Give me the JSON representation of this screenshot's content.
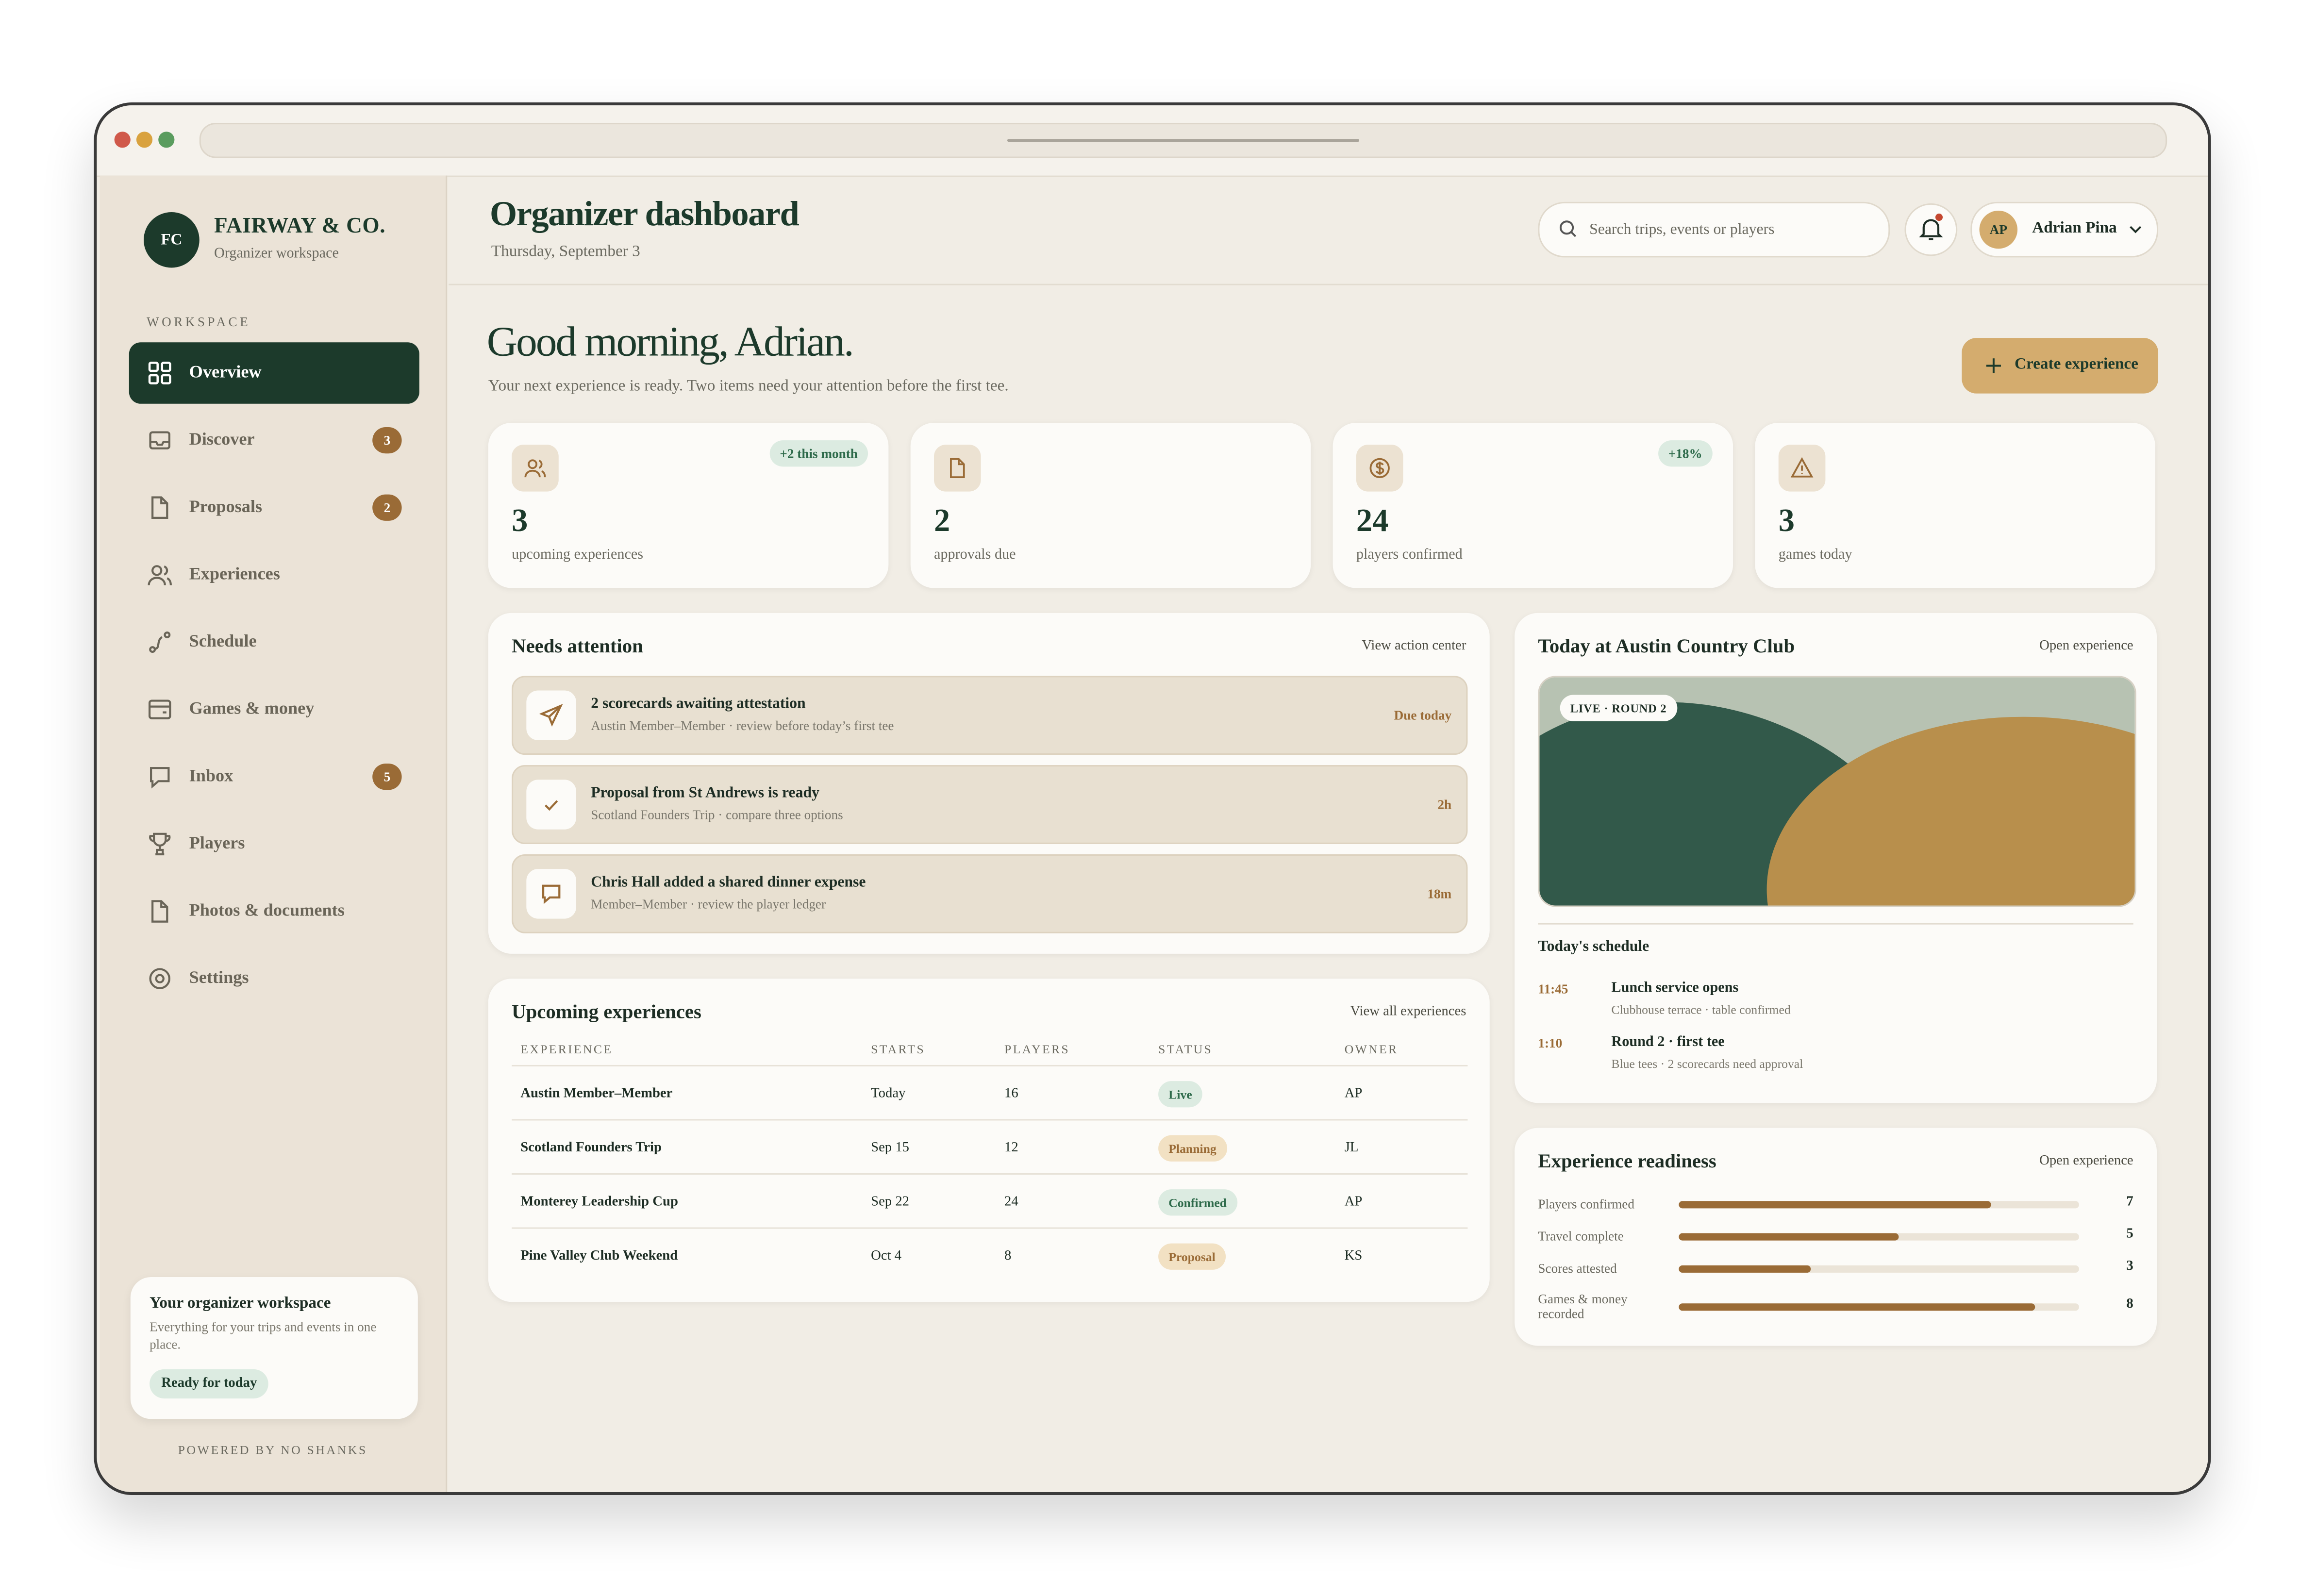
{
  "brand": {
    "initials": "FC",
    "name": "FAIRWAY & CO.",
    "subtitle": "Organizer workspace"
  },
  "sidebar": {
    "section_label": "WORKSPACE",
    "items": [
      {
        "label": "Overview",
        "icon": "grid-icon",
        "active": true,
        "badge": ""
      },
      {
        "label": "Discover",
        "icon": "inbox-tray-icon",
        "badge": "3"
      },
      {
        "label": "Proposals",
        "icon": "document-icon",
        "badge": "2"
      },
      {
        "label": "Experiences",
        "icon": "users-icon",
        "badge": ""
      },
      {
        "label": "Schedule",
        "icon": "route-icon",
        "badge": ""
      },
      {
        "label": "Games & money",
        "icon": "wallet-icon",
        "badge": ""
      },
      {
        "label": "Inbox",
        "icon": "chat-bubble-icon",
        "badge": "5"
      },
      {
        "label": "Players",
        "icon": "trophy-icon",
        "badge": ""
      },
      {
        "label": "Photos & documents",
        "icon": "document-icon",
        "badge": ""
      },
      {
        "label": "Settings",
        "icon": "gear-icon",
        "badge": ""
      }
    ],
    "workspace_card": {
      "title": "Your organizer workspace",
      "description": "Everything for your trips and events in one place.",
      "status": "Ready for today"
    },
    "powered_by": "POWERED BY NO SHANKS"
  },
  "header": {
    "title": "Organizer dashboard",
    "date": "Thursday, September 3",
    "search_placeholder": "Search trips, events or players",
    "user": {
      "initials": "AP",
      "name": "Adrian Pina"
    }
  },
  "greeting": {
    "headline": "Good morning, Adrian.",
    "subtitle": "Your next experience is ready. Two items need your attention before the first tee.",
    "create_button": "Create experience"
  },
  "stats": [
    {
      "value": "3",
      "label": "upcoming experiences",
      "chip": "+2 this month",
      "icon": "users-icon"
    },
    {
      "value": "2",
      "label": "approvals due",
      "chip": "",
      "icon": "document-icon"
    },
    {
      "value": "24",
      "label": "players confirmed",
      "chip": "+18%",
      "icon": "dollar-coin-icon"
    },
    {
      "value": "3",
      "label": "games today",
      "chip": "",
      "icon": "warning-triangle-icon"
    }
  ],
  "attention": {
    "title": "Needs attention",
    "link": "View action center",
    "items": [
      {
        "title": "2 scorecards awaiting attestation",
        "subtitle": "Austin Member–Member · review before today’s first tee",
        "due": "Due today",
        "icon": "send-icon"
      },
      {
        "title": "Proposal from St Andrews is ready",
        "subtitle": "Scotland Founders Trip · compare three options",
        "due": "2h",
        "icon": "check-icon"
      },
      {
        "title": "Chris Hall added a shared dinner expense",
        "subtitle": "Member–Member · review the player ledger",
        "due": "18m",
        "icon": "chat-bubble-icon"
      }
    ]
  },
  "upcoming": {
    "title": "Upcoming experiences",
    "link": "View all experiences",
    "columns": [
      "EXPERIENCE",
      "STARTS",
      "PLAYERS",
      "STATUS",
      "OWNER"
    ],
    "rows": [
      {
        "name": "Austin Member–Member",
        "starts": "Today",
        "players": "16",
        "status": "Live",
        "owner": "AP"
      },
      {
        "name": "Scotland Founders Trip",
        "starts": "Sep 15",
        "players": "12",
        "status": "Planning",
        "owner": "JL"
      },
      {
        "name": "Monterey Leadership Cup",
        "starts": "Sep 22",
        "players": "24",
        "status": "Confirmed",
        "owner": "AP"
      },
      {
        "name": "Pine Valley Club Weekend",
        "starts": "Oct 4",
        "players": "8",
        "status": "Proposal",
        "owner": "KS"
      }
    ]
  },
  "today": {
    "title": "Today at Austin Country Club",
    "link": "Open experience",
    "live_badge": "LIVE · ROUND 2",
    "schedule_title": "Today's schedule",
    "schedule": [
      {
        "time": "11:45",
        "title": "Lunch service opens",
        "subtitle": "Clubhouse terrace · table confirmed"
      },
      {
        "time": "1:10",
        "title": "Round 2 · first tee",
        "subtitle": "Blue tees · 2 scorecards need approval"
      }
    ]
  },
  "readiness": {
    "title": "Experience readiness",
    "link": "Open experience",
    "items": [
      {
        "label": "Players confirmed",
        "value": "7",
        "fraction": 0.78
      },
      {
        "label": "Travel complete",
        "value": "5",
        "fraction": 0.55
      },
      {
        "label": "Scores attested",
        "value": "3",
        "fraction": 0.33
      },
      {
        "label": "Games & money recorded",
        "value": "8",
        "fraction": 0.89
      }
    ]
  },
  "colors": {
    "forest": "#1c3a2b",
    "gold": "#d4ac6e",
    "bronze": "#9a6b36",
    "status_live": "#dcebe1",
    "status_planning": "#f2e1c3",
    "status_confirmed": "#dcebe1",
    "status_proposal": "#f2e1c3"
  }
}
